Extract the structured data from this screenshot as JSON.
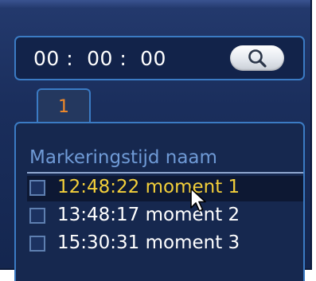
{
  "search": {
    "time_value": "00 :  00 :  00",
    "button_icon": "search-icon"
  },
  "tabs": [
    {
      "label": "1",
      "active": true
    }
  ],
  "list": {
    "header": "Markeringstijd naam",
    "rows": [
      {
        "text": "12:48:22 moment 1",
        "selected": true,
        "checked": false
      },
      {
        "text": "13:48:17 moment 2",
        "selected": false,
        "checked": false
      },
      {
        "text": "15:30:31 moment 3",
        "selected": false,
        "checked": false
      }
    ]
  },
  "colors": {
    "panel_bg": "#1a2e5c",
    "border_accent": "#3b7bc4",
    "header_text": "#6f9ad6",
    "tab_label": "#f08a2a",
    "selected_text": "#f3cf3a",
    "row_text": "#ffffff"
  }
}
